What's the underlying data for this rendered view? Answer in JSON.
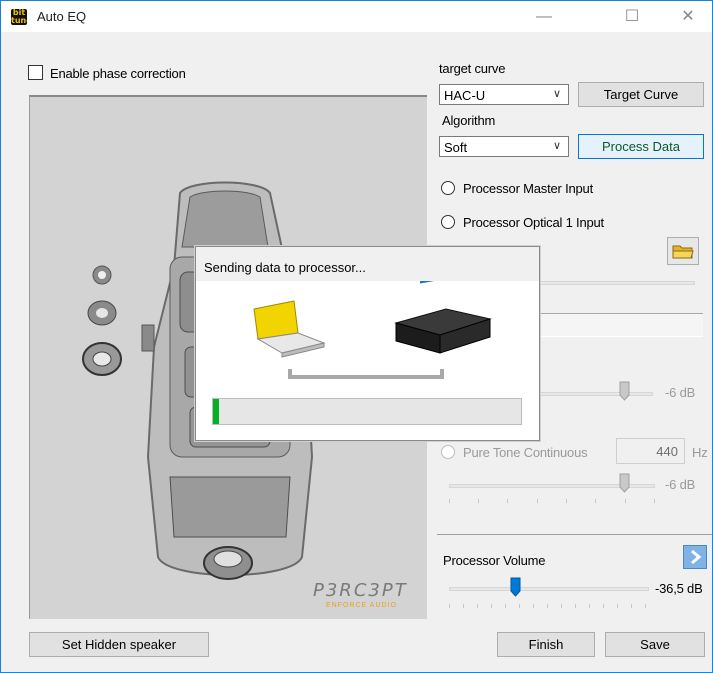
{
  "window": {
    "title": "Auto EQ",
    "minimize": "—",
    "maximize": "☐",
    "close": "✕"
  },
  "left": {
    "phase_correction_label": "Enable phase correction",
    "hidden_speaker_button": "Set Hidden speaker"
  },
  "logo": {
    "main": "P3RC3PT",
    "sub": "ENFORCE AUDIO"
  },
  "right": {
    "target_curve_label": "target curve",
    "target_curve_value": "HAC-U",
    "target_curve_button": "Target Curve",
    "algorithm_label": "Algorithm",
    "algorithm_value": "Soft",
    "process_button": "Process Data",
    "radio_master": "Processor Master Input",
    "radio_optical": "Processor Optical 1 Input",
    "slider1_value": "-6 dB",
    "pure_tone_label": "Pure Tone Continuous",
    "frequency_value": "440",
    "frequency_unit": "Hz",
    "slider2_value": "-6 dB",
    "volume_label": "Processor Volume",
    "volume_value": "-36,5 dB",
    "volume_level": 0.33,
    "finish_button": "Finish",
    "save_button": "Save"
  },
  "dialog": {
    "title": "Sending data to processor...",
    "progress": 0.02
  },
  "colors": {
    "accent": "#0078d7",
    "progress": "#06b025",
    "laptop": "#f2d400"
  }
}
